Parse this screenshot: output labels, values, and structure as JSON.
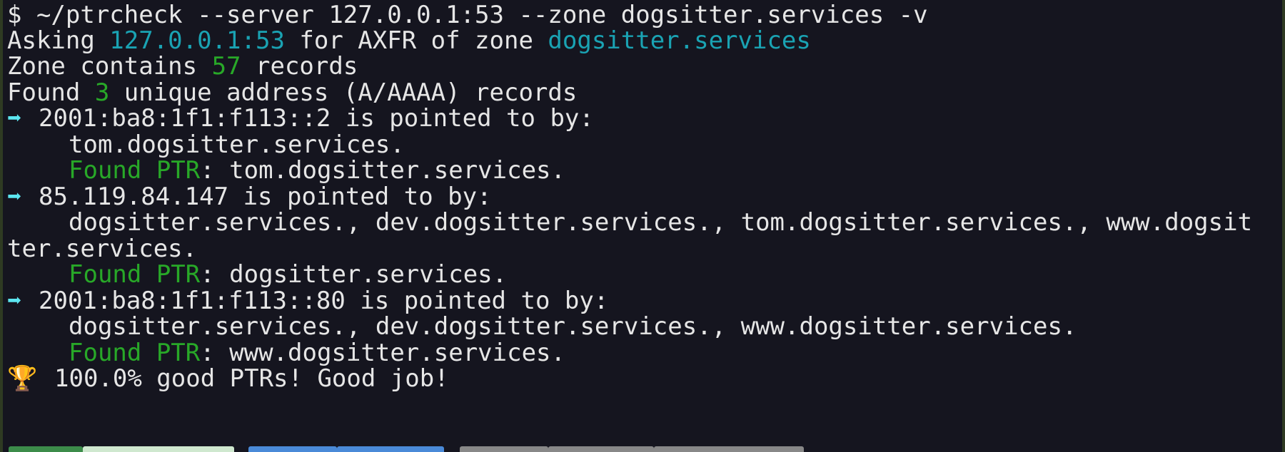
{
  "terminal": {
    "command_line": "$ ~/ptrcheck --server 127.0.0.1:53 --zone dogsitter.services -v",
    "asking": {
      "prefix": "Asking ",
      "server": "127.0.0.1:53",
      "middle": " for AXFR of zone ",
      "zone": "dogsitter.services"
    },
    "zone_count": {
      "prefix": "Zone contains ",
      "count": "57",
      "suffix": " records"
    },
    "unique_count": {
      "prefix": "Found ",
      "count": "3",
      "suffix": " unique address (A/AAAA) records"
    },
    "arrow_glyph": "➡",
    "found_ptr_label": "Found PTR",
    "addresses": [
      {
        "header": "2001:ba8:1f1:f113::2 is pointed to by:",
        "pointers_line1": "tom.dogsitter.services.",
        "ptr_value": ": tom.dogsitter.services."
      },
      {
        "header": "85.119.84.147 is pointed to by:",
        "pointers_line1": "dogsitter.services., dev.dogsitter.services., tom.dogsitter.services., www.dogsit",
        "pointers_line2": "ter.services.",
        "ptr_value": ": dogsitter.services."
      },
      {
        "header": "2001:ba8:1f1:f113::80 is pointed to by:",
        "pointers_line1": "dogsitter.services., dev.dogsitter.services., www.dogsitter.services.",
        "ptr_value": ": www.dogsitter.services."
      }
    ],
    "summary": {
      "icon": "trophy-icon",
      "trophy_glyph": "🏆",
      "text": "100.0% good PTRs! Good job!"
    }
  },
  "colors": {
    "background": "#15151f",
    "text": "#e6e6e6",
    "cyan": "#1aa3b3",
    "green": "#28a828",
    "arrow": "#5ce6f0"
  }
}
